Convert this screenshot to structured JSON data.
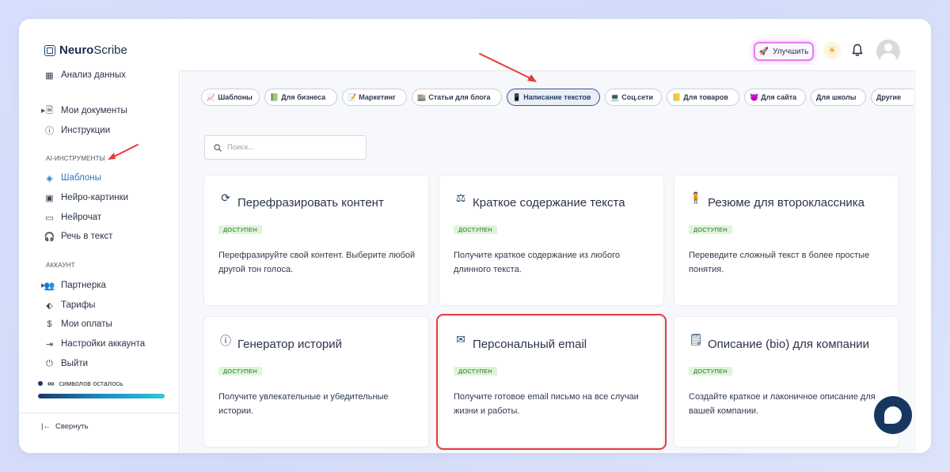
{
  "app": {
    "name_bold": "Neuro",
    "name_rest": "Scribe"
  },
  "header": {
    "upgrade_label": "Улучшить"
  },
  "sidebar": {
    "top_items": [
      {
        "label": "Анализ данных",
        "icon": "grid-icon"
      },
      {
        "label": "Мои документы",
        "icon": "document-icon"
      },
      {
        "label": "Инструкции",
        "icon": "help-icon"
      }
    ],
    "ai_section_title": "AI-ИНСТРУМЕНТЫ",
    "ai_items": [
      {
        "label": "Шаблоны",
        "icon": "layers-icon"
      },
      {
        "label": "Нейро-картинки",
        "icon": "image-icon"
      },
      {
        "label": "Нейрочат",
        "icon": "chat-icon"
      },
      {
        "label": "Речь в текст",
        "icon": "headphones-icon"
      }
    ],
    "account_section_title": "АККАУНТ",
    "account_items": [
      {
        "label": "Партнерка",
        "icon": "users-icon"
      },
      {
        "label": "Тарифы",
        "icon": "tag-icon"
      },
      {
        "label": "Мои оплаты",
        "icon": "dollar-icon"
      },
      {
        "label": "Настройки аккаунта",
        "icon": "logout-arrow-icon"
      },
      {
        "label": "Выйти",
        "icon": "power-icon"
      }
    ],
    "credits_symbol": "∞",
    "credits_label": "символов осталось",
    "collapse_label": "Свернуть"
  },
  "tabs": [
    {
      "label": "Шаблоны",
      "icon": "📈"
    },
    {
      "label": "Для бизнеса",
      "icon": "📗"
    },
    {
      "label": "Маркетинг",
      "icon": "📝"
    },
    {
      "label": "Статьи для блога",
      "icon": "🏬"
    },
    {
      "label": "Написание текстов",
      "icon": "📱"
    },
    {
      "label": "Соц.сети",
      "icon": "💻"
    },
    {
      "label": "Для товаров",
      "icon": "📒"
    },
    {
      "label": "Для сайта",
      "icon": "😈"
    },
    {
      "label": "Для школы",
      "icon": ""
    },
    {
      "label": "Другие",
      "icon": ""
    }
  ],
  "search": {
    "placeholder": "Поиск..."
  },
  "cards": [
    {
      "title": "Перефразировать контент",
      "badge": "ДОСТУПЕН",
      "desc": "Перефразируйте свой контент. Выберите любой другой тон голоса.",
      "icon": "refresh-icon"
    },
    {
      "title": "Краткое содержание текста",
      "badge": "ДОСТУПЕН",
      "desc": "Получите краткое содержание из любого длинного текста.",
      "icon": "summary-icon"
    },
    {
      "title": "Резюме для второклассника",
      "badge": "ДОСТУПЕН",
      "desc": "Переведите сложный текст в более простые понятия.",
      "icon": "child-icon"
    },
    {
      "title": "Генератор историй",
      "badge": "ДОСТУПЕН",
      "desc": "Получите увлекательные и убедительные истории.",
      "icon": "story-icon"
    },
    {
      "title": "Персональный email",
      "badge": "ДОСТУПЕН",
      "desc": "Получите готовое email письмо на все случаи жизни и работы.",
      "icon": "envelope-icon"
    },
    {
      "title": "Описание (bio) для компании",
      "badge": "ДОСТУПЕН",
      "desc": "Создайте краткое и лаконичное описание для вашей компании.",
      "icon": "doc-badge-icon"
    }
  ],
  "colors": {
    "accent": "#2b7cc4",
    "brand_dark": "#173761",
    "highlight": "#e23c3c",
    "badge_bg": "#dcf6d7"
  }
}
